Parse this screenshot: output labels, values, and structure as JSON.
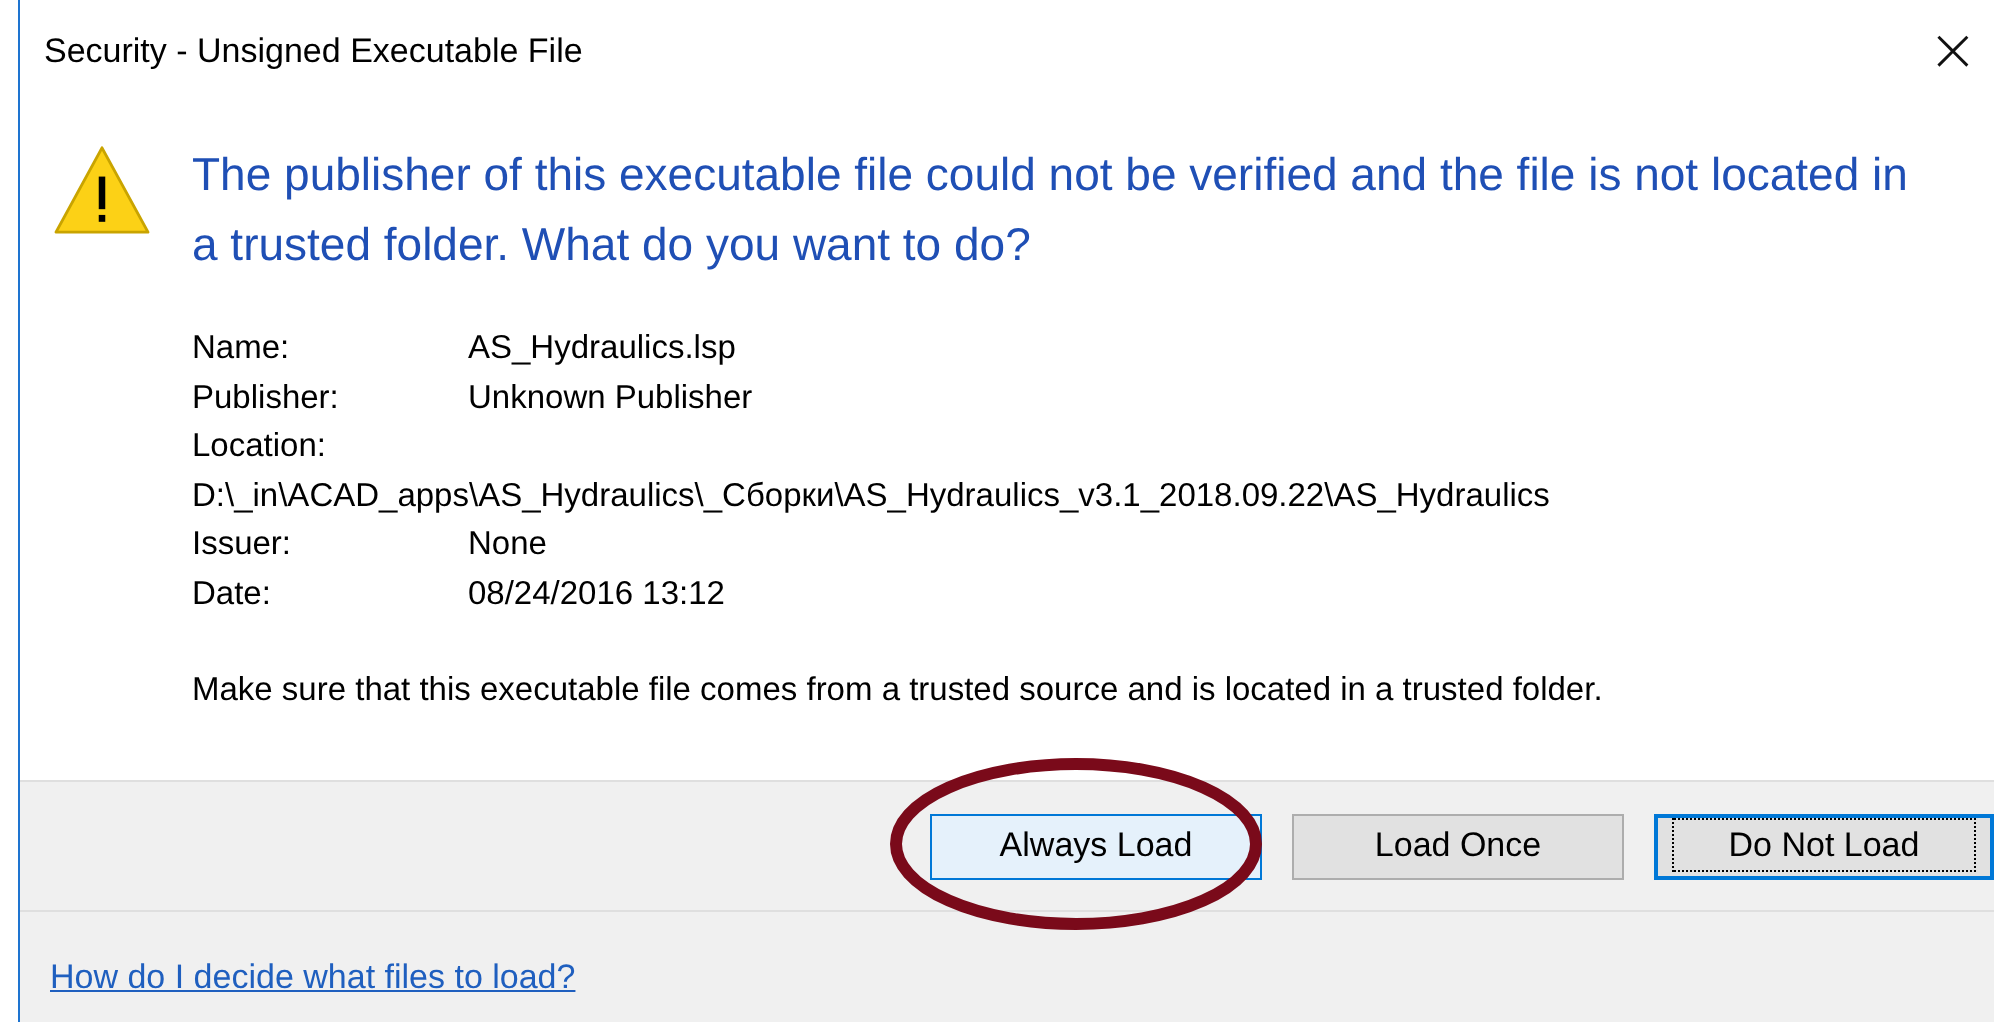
{
  "window": {
    "title": "Security - Unsigned Executable File",
    "close": "×"
  },
  "heading": "The publisher of this executable file could not be verified and the file is not located in a trusted folder. What do you want to do?",
  "details": [
    {
      "label": "Name:",
      "value": "AS_Hydraulics.lsp"
    },
    {
      "label": "Publisher:",
      "value": "Unknown Publisher"
    },
    {
      "label": "Location:",
      "value": "D:\\_in\\ACAD_apps\\AS_Hydraulics\\_Сборки\\AS_Hydraulics_v3.1_2018.09.22\\AS_Hydraulics",
      "kind": "wide"
    },
    {
      "label": "Issuer:",
      "value": "None"
    },
    {
      "label": "Date:",
      "value": "08/24/2016  13:12"
    }
  ],
  "note": "Make sure that this executable file comes from a trusted source and is located in a trusted folder.",
  "buttons": [
    {
      "label": "Always Load",
      "hovered": true,
      "focused": false,
      "circled": true
    },
    {
      "label": "Load Once",
      "hovered": false,
      "focused": false,
      "circled": false
    },
    {
      "label": "Do Not Load",
      "hovered": false,
      "focused": true,
      "circled": false
    }
  ],
  "help_link": "How do I decide what files to load?"
}
